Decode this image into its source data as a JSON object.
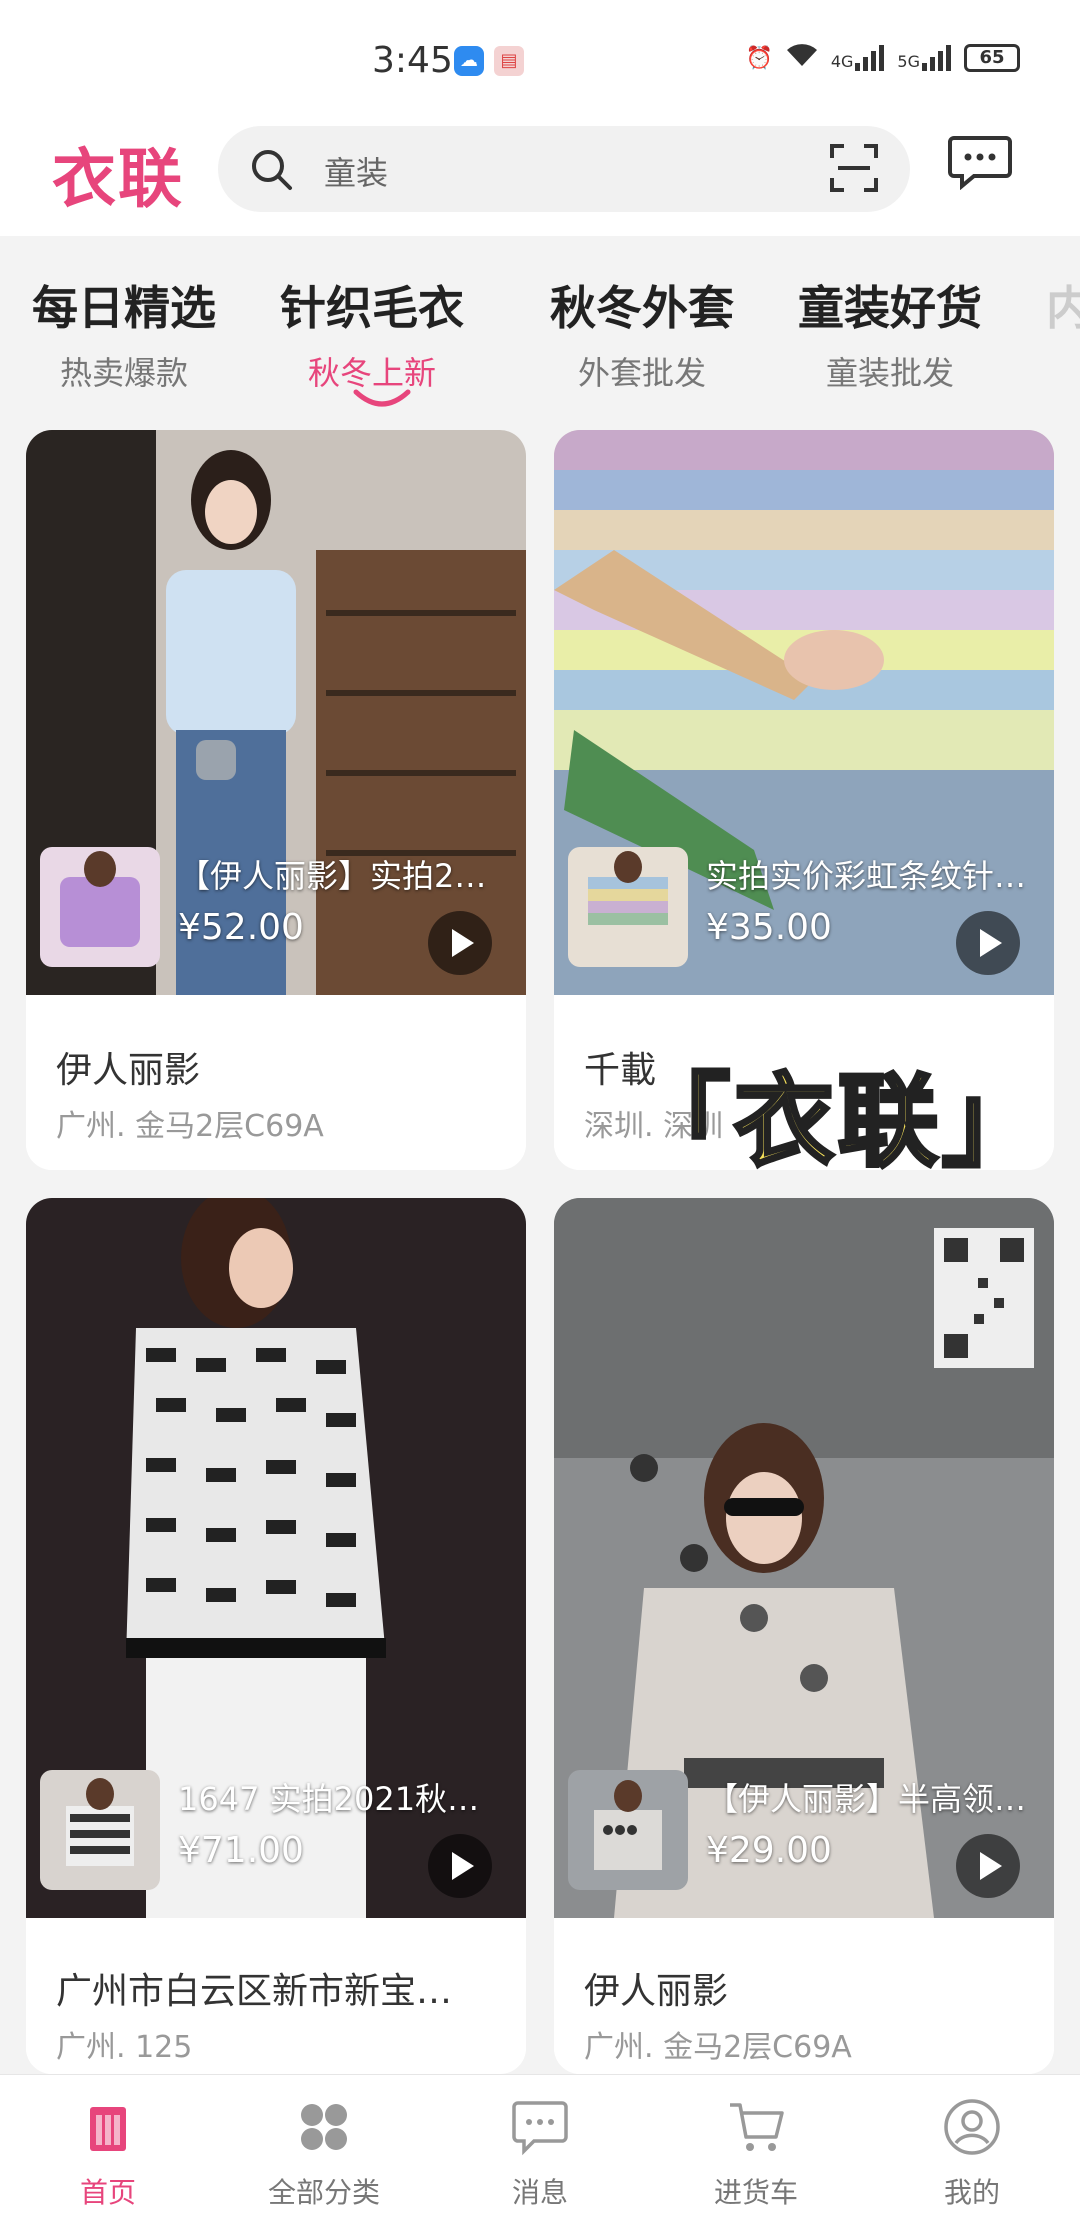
{
  "status_bar": {
    "time": "3:45",
    "battery": "65",
    "net1": "4G",
    "net2": "5G"
  },
  "header": {
    "logo": "衣联",
    "search_placeholder": "童装"
  },
  "tabs": [
    {
      "title": "每日精选",
      "sub": "热卖爆款"
    },
    {
      "title": "针织毛衣",
      "sub": "秋冬上新",
      "active": true
    },
    {
      "title": "秋冬外套",
      "sub": "外套批发"
    },
    {
      "title": "童装好货",
      "sub": "童装批发"
    },
    {
      "title": "内",
      "sub": ""
    }
  ],
  "products": [
    {
      "title": "【伊人丽影】实拍2…",
      "price": "¥52.00",
      "shop": "伊人丽影",
      "location": "广州. 金马2层C69A"
    },
    {
      "title": "实拍实价彩虹条纹针…",
      "price": "¥35.00",
      "shop": "千載",
      "location": "深圳. 深圳"
    },
    {
      "title": "1647 实拍2021秋针…",
      "price": "¥71.00",
      "shop": "广州市白云区新市新宝…",
      "location": "广州. 125"
    },
    {
      "title": "【伊人丽影】半高领…",
      "price": "¥29.00",
      "shop": "伊人丽影",
      "location": "广州. 金马2层C69A"
    }
  ],
  "watermark": "「衣联」",
  "bottom_nav": [
    {
      "label": "首页",
      "icon": "home-icon",
      "active": true
    },
    {
      "label": "全部分类",
      "icon": "category-icon"
    },
    {
      "label": "消息",
      "icon": "message-icon"
    },
    {
      "label": "进货车",
      "icon": "cart-icon"
    },
    {
      "label": "我的",
      "icon": "profile-icon"
    }
  ],
  "colors": {
    "brand": "#e7457c",
    "background": "#f3f3f3"
  }
}
